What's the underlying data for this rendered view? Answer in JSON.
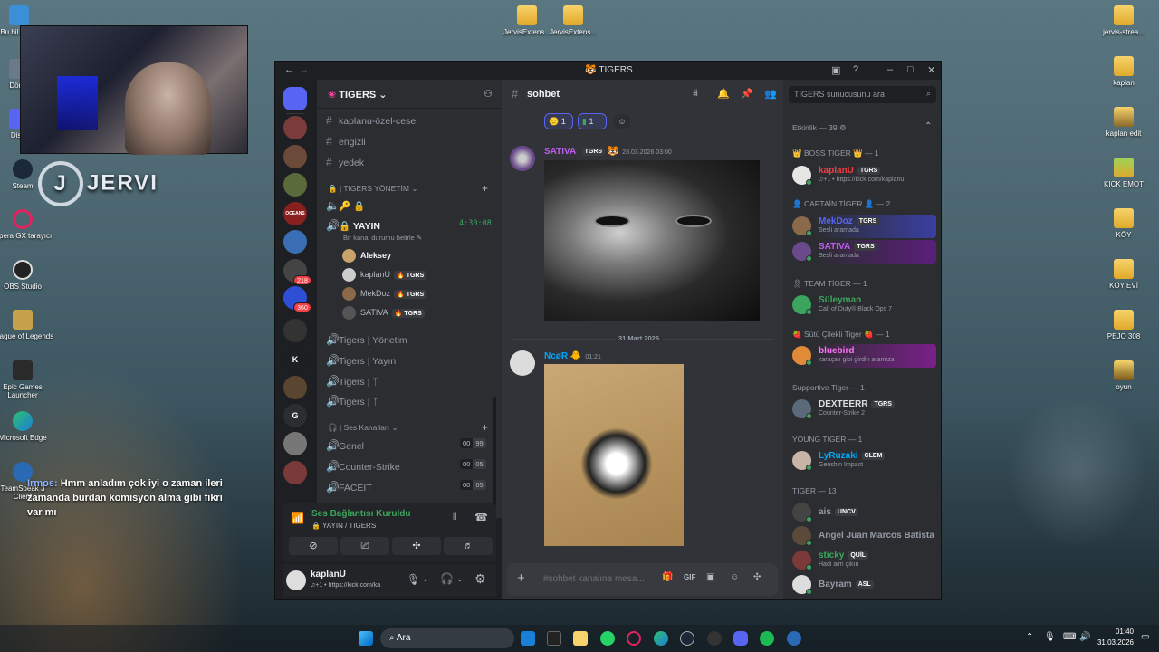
{
  "desktop": {
    "icons_left": [
      {
        "label": "Bu bil... - Kı"
      },
      {
        "label": "Dön..."
      },
      {
        "label": "Dis..."
      },
      {
        "label": "Steam"
      },
      {
        "label": "Opera GX tarayıcı"
      },
      {
        "label": "OBS Studio"
      },
      {
        "label": "League of Legends"
      },
      {
        "label": "Epic Games Launcher"
      },
      {
        "label": "Microsoft Edge"
      },
      {
        "label": "TeamSpeak 3 Client"
      }
    ],
    "icons_top": [
      {
        "label": "JervisExtens..."
      },
      {
        "label": "JervisExtens..."
      }
    ],
    "icons_right": [
      {
        "label": "jervis-strea..."
      },
      {
        "label": "kaplan"
      },
      {
        "label": "kaplan edit"
      },
      {
        "label": "KICK EMOT"
      },
      {
        "label": "KÖY"
      },
      {
        "label": "KÖY EVİ"
      },
      {
        "label": "PEJO 308"
      },
      {
        "label": "oyun"
      }
    ],
    "stream_logo": "JERVI",
    "stream_logo_letter": "J",
    "chat_overlay": {
      "name": "Irmos:",
      "text": "Hmm anladım çok iyi o zaman ileri zamanda burdan komisyon alma gibi fikri var mı"
    }
  },
  "window": {
    "title": "TIGERS"
  },
  "guilds": [
    {
      "label": "",
      "color": "#5865f2"
    },
    {
      "label": "",
      "color": "#7a3b3b"
    },
    {
      "label": "",
      "color": "#6b4a3a"
    },
    {
      "label": "",
      "color": "#5a6a3a"
    },
    {
      "label": "OCEANS",
      "color": "#8a1f1f"
    },
    {
      "label": "",
      "color": "#3b6fb5"
    },
    {
      "label": "",
      "color": "#444",
      "badge": "218"
    },
    {
      "label": "",
      "color": "#2d4fd6",
      "badge": "360"
    },
    {
      "label": "",
      "color": "#333"
    },
    {
      "label": "K",
      "color": "#1e1f22"
    },
    {
      "label": "",
      "color": "#5a4630"
    },
    {
      "label": "G",
      "color": "#2b2d31"
    },
    {
      "label": "",
      "color": "#777"
    },
    {
      "label": "",
      "color": "#7a3a3a"
    }
  ],
  "server": {
    "name": "TIGERS",
    "channels_top": [
      "kaplanu-özel-cese",
      "engizli",
      "yedek"
    ],
    "category1": "| TIGERS YÖNETİM",
    "category1_icons": "🔑 🔒",
    "live_channel": {
      "name": "YAYIN",
      "timer": "4:30:08",
      "status": "Bir kanal durumu belirle"
    },
    "voice_users": [
      {
        "name": "Aleksey",
        "tag": "",
        "color": "#c9a36a"
      },
      {
        "name": "kaplanU",
        "tag": "TGRS",
        "color": "#cccccc"
      },
      {
        "name": "MekDoz",
        "tag": "TGRS",
        "color": "#8a6a4a"
      },
      {
        "name": "SATIVA",
        "tag": "TGRS",
        "color": "#555555"
      }
    ],
    "voice_channels": [
      "Tigers | Yönetim",
      "Tigers | Yayın",
      "Tigers | ᛉ",
      "Tigers | ᛉ"
    ],
    "category2": "| Ses Kanalları",
    "sound_channels": [
      {
        "name": "Genel",
        "a": "00",
        "b": "99"
      },
      {
        "name": "Counter-Strike",
        "a": "00",
        "b": "05"
      },
      {
        "name": "FACEIT",
        "a": "00",
        "b": "05"
      }
    ]
  },
  "voice_panel": {
    "status": "Ses Bağlantısı Kuruldu",
    "channel": "YAYIN / TIGERS"
  },
  "user_panel": {
    "name": "kaplanU",
    "status": "♫+1 • https://kick.com/ka"
  },
  "chat": {
    "channel": "sohbet",
    "reactions": [
      {
        "emoji": "🙂",
        "count": "1"
      },
      {
        "emoji": "▮",
        "count": "1"
      }
    ],
    "msg1": {
      "author": "SATIVA",
      "tag": "TGRS",
      "time": "28.03.2026 03:00"
    },
    "date_divider": "31 Mart 2026",
    "msg2": {
      "author": "NcøR",
      "time": "01:21"
    },
    "composer_placeholder": "#sohbet kanalına mesa..."
  },
  "members": {
    "search_placeholder": "TIGERS sunucusunu ara",
    "activity_header": "Etkinlik — 39",
    "groups": [
      {
        "title": "👑 BOSS TIGER 👑 — 1",
        "members": [
          {
            "name": "kaplanU",
            "tag": "TGRS",
            "status": "♫+1 • https://kick.com/kaplanu",
            "color": "#f23f43",
            "av": "#e6e6e6"
          }
        ]
      },
      {
        "title": "👤 CAPTAİN TİGER 👤 — 2",
        "members": [
          {
            "name": "MekDoz",
            "tag": "TGRS",
            "status": "Sesli aramada",
            "color": "#5865f2",
            "av": "#8a6a4a",
            "bg": "#3b3fa0"
          },
          {
            "name": "SATIVA",
            "tag": "TGRS",
            "status": "Sesli aramada",
            "color": "#c05bf2",
            "av": "#6a4a8a",
            "bg": "#5a1f7a"
          }
        ]
      },
      {
        "title": "🎗 TEAM TİGER — 1",
        "members": [
          {
            "name": "Süleyman",
            "tag": "",
            "status": "Call of Duty® Black Ops 7",
            "color": "#3ba55d",
            "av": "#3ba55d"
          }
        ]
      },
      {
        "title": "🍓 Sütü Çilekli Tiger 🍓 — 1",
        "members": [
          {
            "name": "bluebird",
            "tag": "",
            "status": "karaçalı gibi girdin aramıza",
            "color": "#ff73fa",
            "av": "#e08a3a",
            "bg": "#7a1f8a"
          }
        ]
      },
      {
        "title": "Supportive Tiger — 1",
        "members": [
          {
            "name": "DEXTEERR",
            "tag": "TGRS",
            "status": "Counter-Strike 2",
            "color": "#dbdee1",
            "av": "#5a6a7a"
          }
        ]
      },
      {
        "title": "YOUNG TIGER — 1",
        "members": [
          {
            "name": "LyRuzaki",
            "tag": "CLEM",
            "status": "Genshin Impact",
            "color": "#00a8fc",
            "av": "#c9b3a6"
          }
        ]
      },
      {
        "title": "TIGER — 13",
        "members": [
          {
            "name": "ais",
            "tag": "UNCV",
            "status": "",
            "color": "#949ba4",
            "av": "#444"
          },
          {
            "name": "Angel Juan Marcos Batista",
            "tag": "",
            "status": "",
            "color": "#949ba4",
            "av": "#5a4a3a"
          },
          {
            "name": "sticky",
            "tag": "QUİL",
            "status": "Hadi aim çıkın",
            "color": "#3ba55d",
            "av": "#7a3a3a"
          },
          {
            "name": "Bayram",
            "tag": "ASL",
            "status": "",
            "color": "#949ba4",
            "av": "#ddd"
          }
        ]
      }
    ]
  },
  "taskbar": {
    "search": "Ara",
    "time": "01:40",
    "date": "31.03.2026"
  }
}
